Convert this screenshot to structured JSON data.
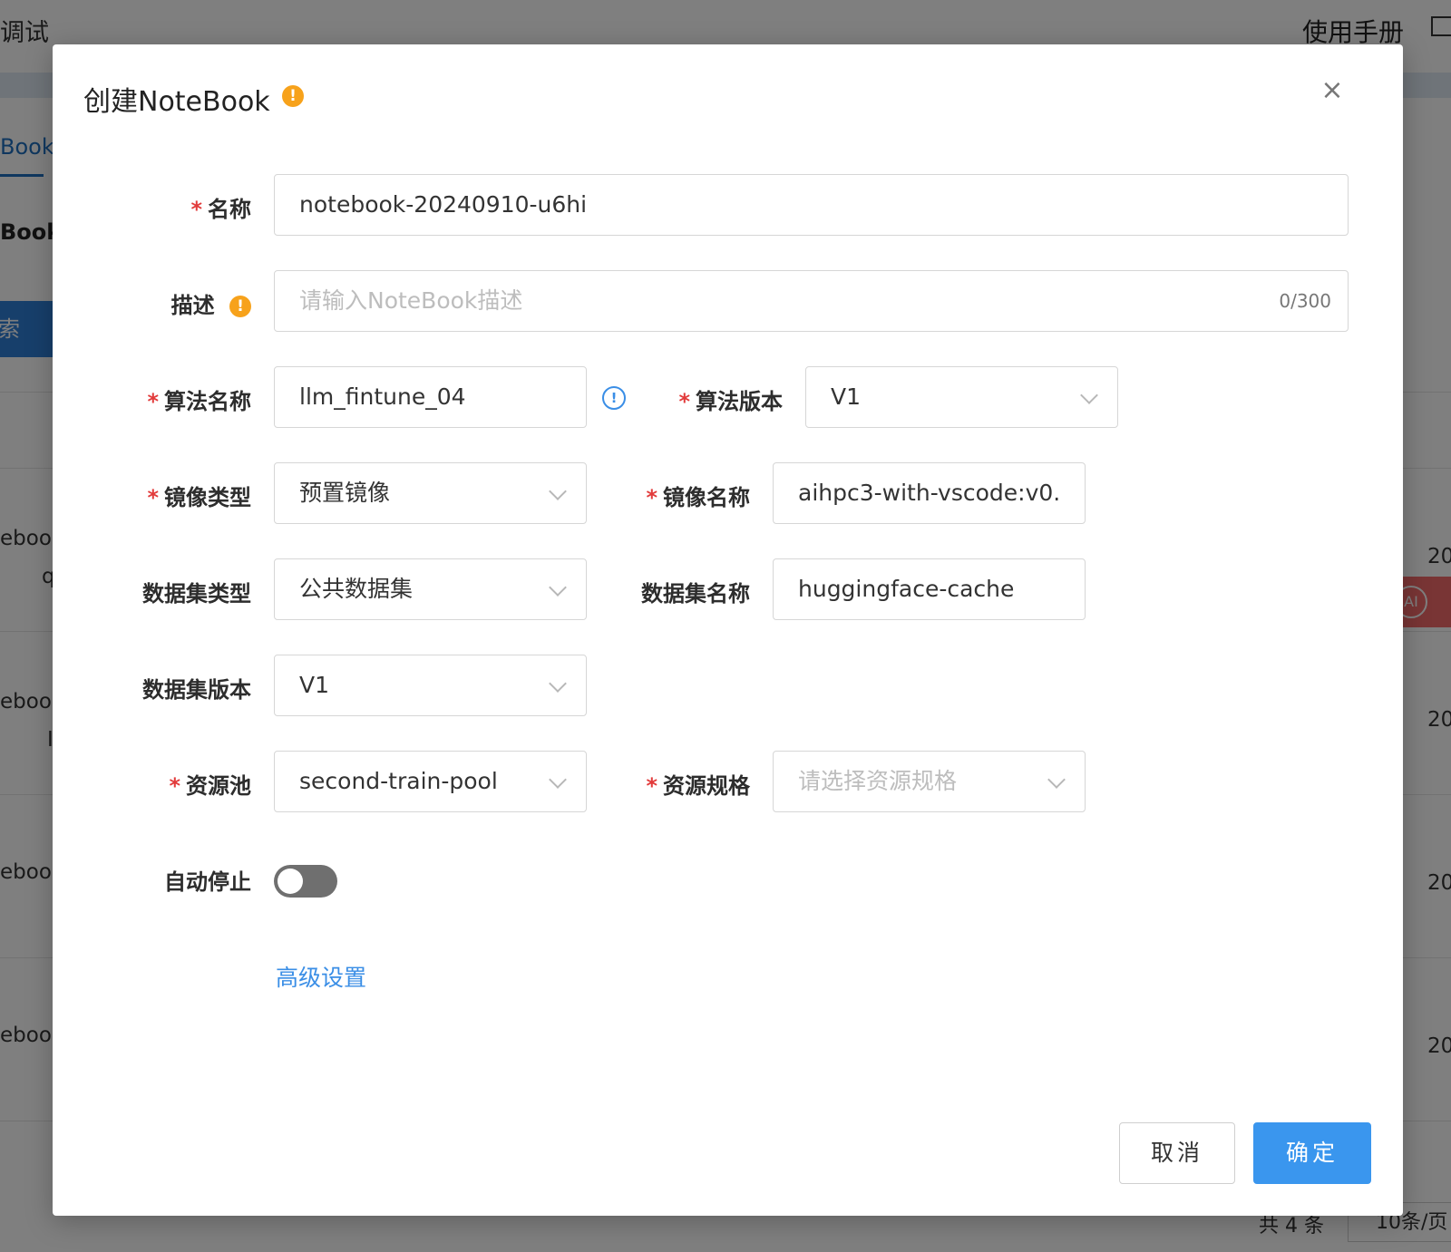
{
  "background": {
    "top_left_text": "调试",
    "top_right_text": "使用手册",
    "tab_text": "Book",
    "subtitle_text": "Book",
    "search_button": "索",
    "rows": [
      {
        "text_a": "eboo",
        "text_b": "q",
        "date": "20"
      },
      {
        "text_a": "eboo",
        "text_b": "I",
        "date": "20"
      },
      {
        "text_a": "ebook",
        "text_b": "",
        "date": "20"
      },
      {
        "text_a": "ebook",
        "text_b": "",
        "date": "20"
      }
    ],
    "ai_badge": "AI",
    "total_text": "共 4 条",
    "page_size": "10条/页"
  },
  "modal": {
    "title": "创建NoteBook",
    "title_warn_icon": "!",
    "close_icon": "×",
    "form": {
      "name_label": "名称",
      "name_value": "notebook-20240910-u6hi",
      "desc_label": "描述",
      "desc_warn_icon": "!",
      "desc_placeholder": "请输入NoteBook描述",
      "desc_counter": "0/300",
      "algo_name_label": "算法名称",
      "algo_name_value": "llm_fintune_04",
      "algo_info_icon": "!",
      "algo_version_label": "算法版本",
      "algo_version_value": "V1",
      "image_type_label": "镜像类型",
      "image_type_value": "预置镜像",
      "image_name_label": "镜像名称",
      "image_name_value": "aihpc3-with-vscode:v0.",
      "dataset_type_label": "数据集类型",
      "dataset_type_value": "公共数据集",
      "dataset_name_label": "数据集名称",
      "dataset_name_value": "huggingface-cache",
      "dataset_version_label": "数据集版本",
      "dataset_version_value": "V1",
      "resource_pool_label": "资源池",
      "resource_pool_value": "second-train-pool",
      "resource_spec_label": "资源规格",
      "resource_spec_placeholder": "请选择资源规格",
      "auto_stop_label": "自动停止",
      "auto_stop_on": false,
      "advanced_link": "高级设置",
      "required_mark": "*"
    },
    "buttons": {
      "cancel": "取消",
      "ok": "确定"
    }
  },
  "colors": {
    "primary": "#3a96ee",
    "link": "#3a8ee6",
    "warning": "#f7a21b",
    "required": "#e23b3b",
    "toggle_off": "#6f6f6f"
  }
}
